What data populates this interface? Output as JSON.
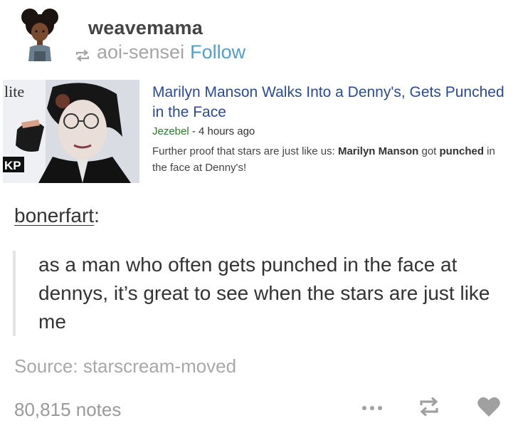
{
  "post": {
    "username": "weavemama",
    "reblogged_from": "aoi-sensei",
    "follow_label": "Follow"
  },
  "link_card": {
    "title": "Marilyn Manson Walks Into a Denny's, Gets Punched in the Face",
    "publisher": "Jezebel",
    "time_ago": " - 4 hours ago",
    "desc_part1": "Further proof that stars are just like us: ",
    "desc_bold": "Marilyn Manson",
    "desc_part2": " got ",
    "desc_bold2": "punched",
    "desc_part3": " in the face at Denny's!",
    "thumb_text_top": "lite",
    "thumb_text_bottom": "KP"
  },
  "quote": {
    "user": "bonerfart",
    "suffix": ":",
    "text": "as a man who often gets punched in the face at dennys, it’s great to see when the stars are just like me"
  },
  "footer": {
    "source_label": "Source: starscream-moved",
    "notes": "80,815 notes"
  },
  "icons": {
    "reblog_small": "reblog-icon",
    "more": "more-options-icon",
    "reblog": "reblog-icon",
    "like": "heart-icon"
  },
  "colors": {
    "link_blue": "#529ecc",
    "card_title": "#2a4a9a",
    "publisher_green": "#2b7a2b",
    "muted_gray": "#a5a5a5"
  }
}
